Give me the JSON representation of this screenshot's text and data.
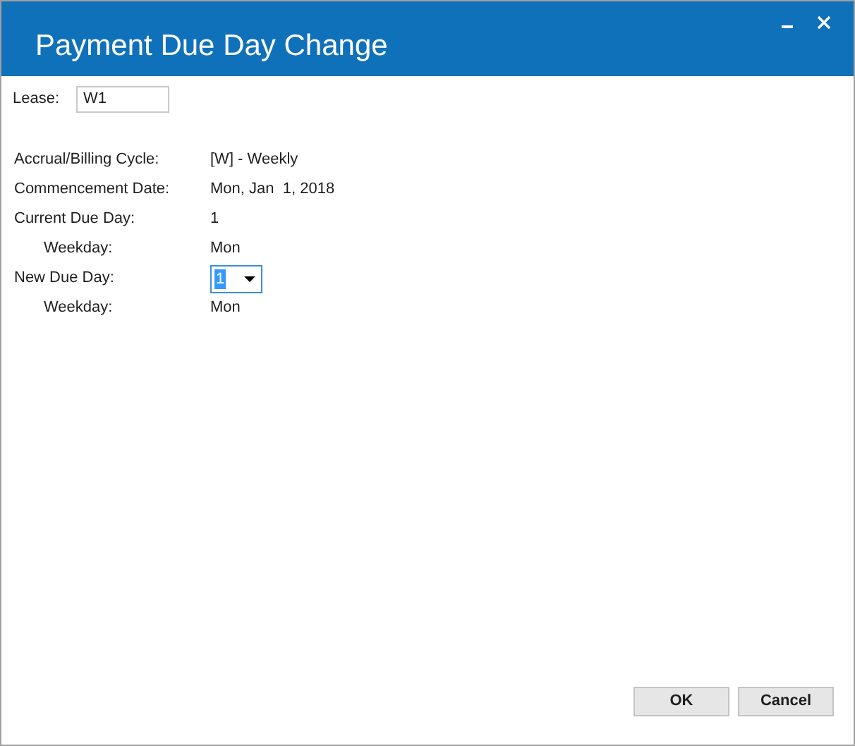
{
  "window": {
    "title": "Payment Due Day Change"
  },
  "lease": {
    "label": "Lease:",
    "value": "W1"
  },
  "fields": [
    {
      "kind": "value",
      "label": "Accrual/Billing Cycle:",
      "value": "[W] - Weekly"
    },
    {
      "kind": "value",
      "label": "Commencement Date:",
      "value": "Mon, Jan  1, 2018"
    },
    {
      "kind": "value",
      "label": "Current Due Day:",
      "value": "1",
      "children": [
        {
          "kind": "value",
          "label": "Weekday:",
          "value": "Mon"
        }
      ]
    },
    {
      "kind": "dropdown",
      "label": "New Due Day:",
      "value": "1",
      "children": [
        {
          "kind": "value",
          "label": "Weekday:",
          "value": "Mon"
        }
      ]
    }
  ],
  "buttons": [
    "OK",
    "Cancel"
  ]
}
